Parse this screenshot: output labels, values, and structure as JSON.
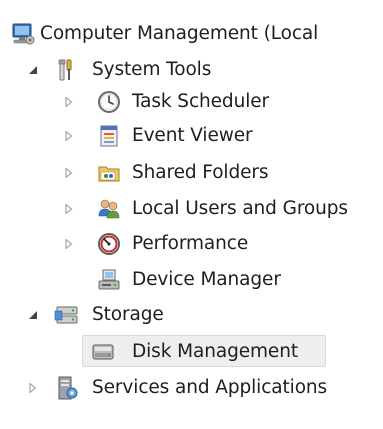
{
  "tree": {
    "root": {
      "label": "Computer Management (Local",
      "icon": "computer-management-icon",
      "expanded": true
    },
    "system_tools": {
      "label": "System Tools",
      "icon": "tools-icon",
      "expanded": true
    },
    "task_scheduler": {
      "label": "Task Scheduler",
      "icon": "clock-icon",
      "expanded": false
    },
    "event_viewer": {
      "label": "Event Viewer",
      "icon": "event-viewer-icon",
      "expanded": false
    },
    "shared_folders": {
      "label": "Shared Folders",
      "icon": "shared-folder-icon",
      "expanded": false
    },
    "local_users": {
      "label": "Local Users and Groups",
      "icon": "users-icon",
      "expanded": false
    },
    "performance": {
      "label": "Performance",
      "icon": "performance-icon",
      "expanded": false
    },
    "device_manager": {
      "label": "Device Manager",
      "icon": "device-manager-icon"
    },
    "storage": {
      "label": "Storage",
      "icon": "storage-icon",
      "expanded": true
    },
    "disk_management": {
      "label": "Disk Management",
      "icon": "disk-icon",
      "selected": true
    },
    "services": {
      "label": "Services and Applications",
      "icon": "services-icon",
      "expanded": false
    }
  },
  "colors": {
    "selection_bg": "#eeeeee",
    "selection_border": "#dadada",
    "expander_collapsed": "#a6a6a6",
    "expander_expanded": "#444444",
    "text": "#1e1e1e"
  }
}
